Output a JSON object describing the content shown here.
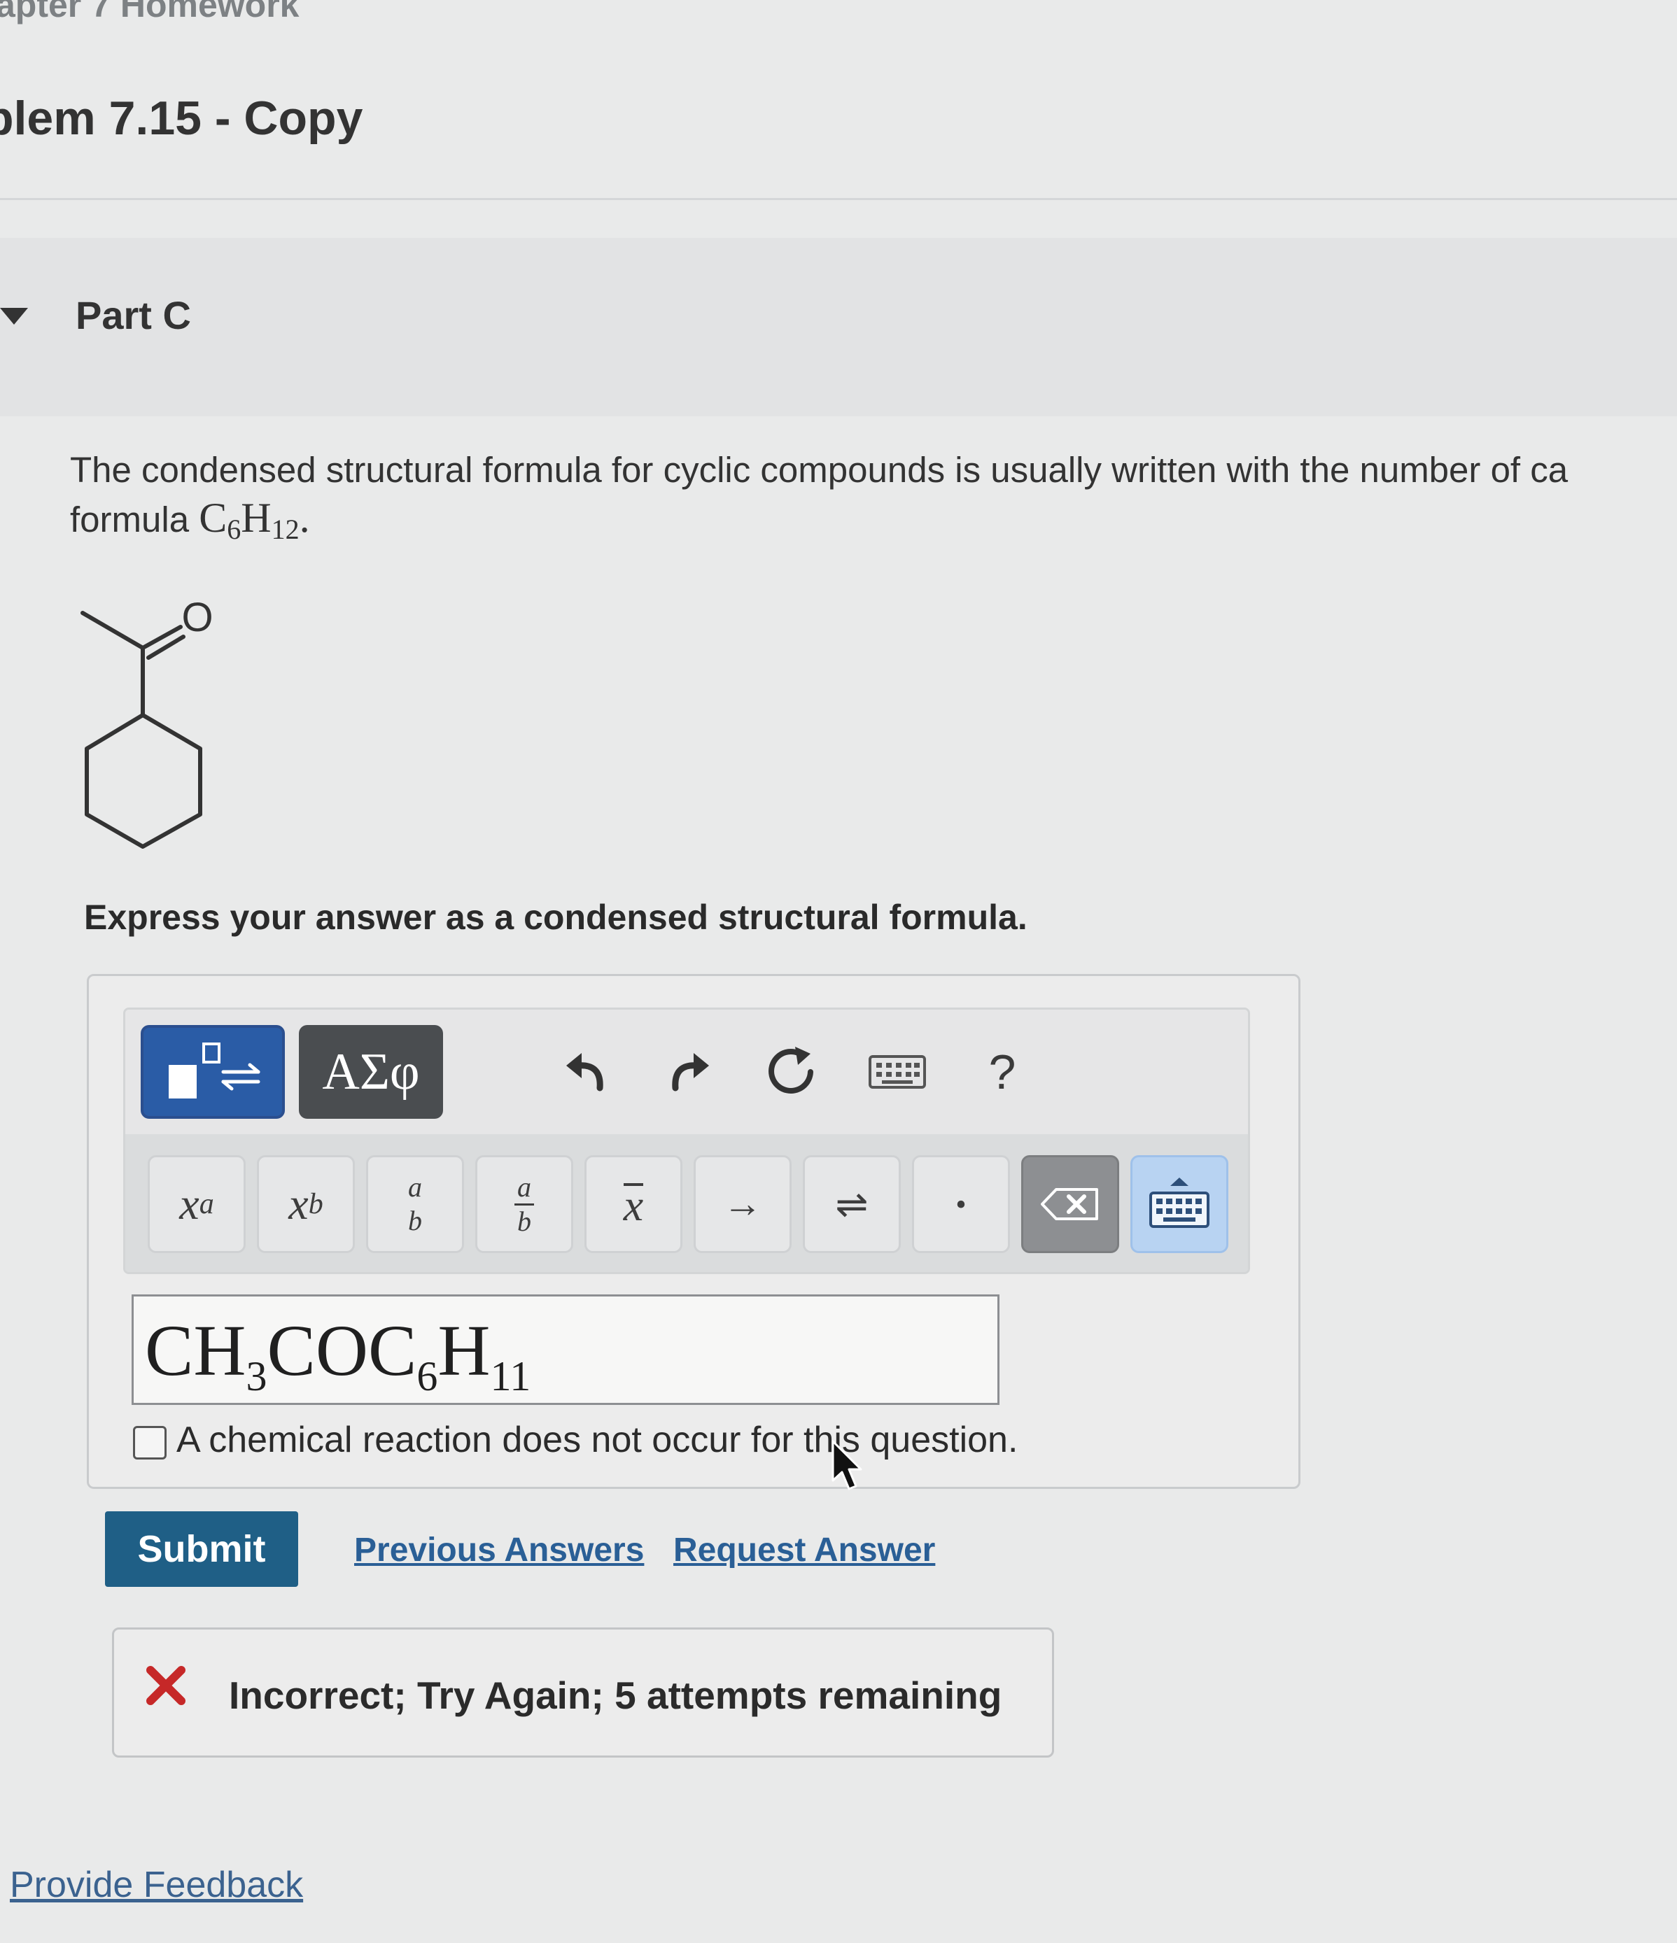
{
  "header": {
    "breadcrumb": "apter 7 Homework",
    "problem_title": "blem 7.15 - Copy"
  },
  "part": {
    "label": "Part C"
  },
  "question": {
    "intro": "The condensed structural formula for cyclic compounds is usually written with the number of ca",
    "line2_prefix": "formula ",
    "formula_c": "C",
    "formula_c_sub": "6",
    "formula_h": "H",
    "formula_h_sub": "12",
    "formula_end": ".",
    "atom_label": "O",
    "instruction": "Express your answer as a condensed structural formula."
  },
  "toolbar": {
    "templates_icon": "templates-icon",
    "greek_label": "ΑΣφ",
    "undo_icon": "undo-icon",
    "redo_icon": "redo-icon",
    "reset_icon": "reset-icon",
    "keyboard_icon": "keyboard-icon",
    "help_label": "?",
    "symbols": {
      "superscript": "x",
      "superscript_sup": "a",
      "subscript": "x",
      "subscript_sub": "b",
      "stacked_top": "a",
      "stacked_bottom": "b",
      "fraction_top": "a",
      "fraction_bottom": "b",
      "overbar": "x",
      "arrow": "→",
      "equilibrium": "⇌",
      "dot": "•"
    }
  },
  "answer": {
    "p1": "CH",
    "s1": "3",
    "p2": "COC",
    "s2": "6",
    "p3": "H",
    "s3": "11"
  },
  "checkbox": {
    "label": "A chemical reaction does not occur for this question.",
    "checked": false
  },
  "actions": {
    "submit": "Submit",
    "previous_answers": "Previous Answers",
    "request_answer": "Request Answer"
  },
  "feedback": {
    "message": "Incorrect; Try Again; 5 attempts remaining",
    "status_color": "#c62828"
  },
  "footer": {
    "provide_feedback": "Provide Feedback"
  },
  "colors": {
    "submit": "#1f5f86",
    "templates_button": "#2a5ca6",
    "link": "#2a5f96"
  }
}
